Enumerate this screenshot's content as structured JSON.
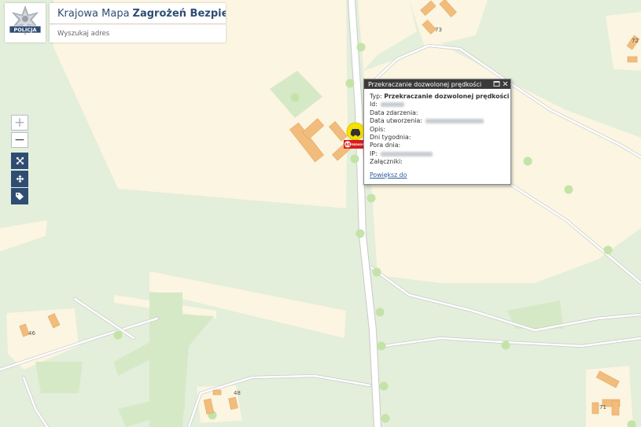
{
  "app": {
    "title_prefix": "Krajowa Mapa",
    "title_bold": "Zagrożeń Bezpieczeństwa",
    "logo_text": "POLICJA"
  },
  "search": {
    "placeholder": "Wyszukaj adres",
    "value": ""
  },
  "controls": {
    "zoom_in": "+",
    "zoom_out": "−",
    "tools": [
      "fullscreen-icon",
      "locate-icon",
      "tag-icon"
    ]
  },
  "popup": {
    "header": "Przekraczanie dozwolonej prędkości",
    "rows": {
      "typ_label": "Typ:",
      "typ_value": "Przekraczanie dozwolonej prędkości",
      "id_label": "Id:",
      "data_zdarzenia_label": "Data zdarzenia:",
      "data_utworzenia_label": "Data utworzenia:",
      "opis_label": "Opis:",
      "dni_tygodnia_label": "Dni tygodnia:",
      "pora_dnia_label": "Pora dnia:",
      "ip_label": "IP:",
      "zalaczniki_label": "Załączniki:"
    },
    "link": "Powiększ do"
  },
  "marker": {
    "label": "PRĘDKOŚĆ",
    "color": "#f5e000"
  },
  "house_numbers": [
    "46",
    "48",
    "71",
    "72",
    "73"
  ],
  "colors": {
    "map_bg": "#e3eedb",
    "field": "#fbf5e1",
    "road": "#ffffff",
    "trees": "#c4e3a8",
    "building": "#f2bd7c",
    "brand_navy": "#2f4d73"
  }
}
